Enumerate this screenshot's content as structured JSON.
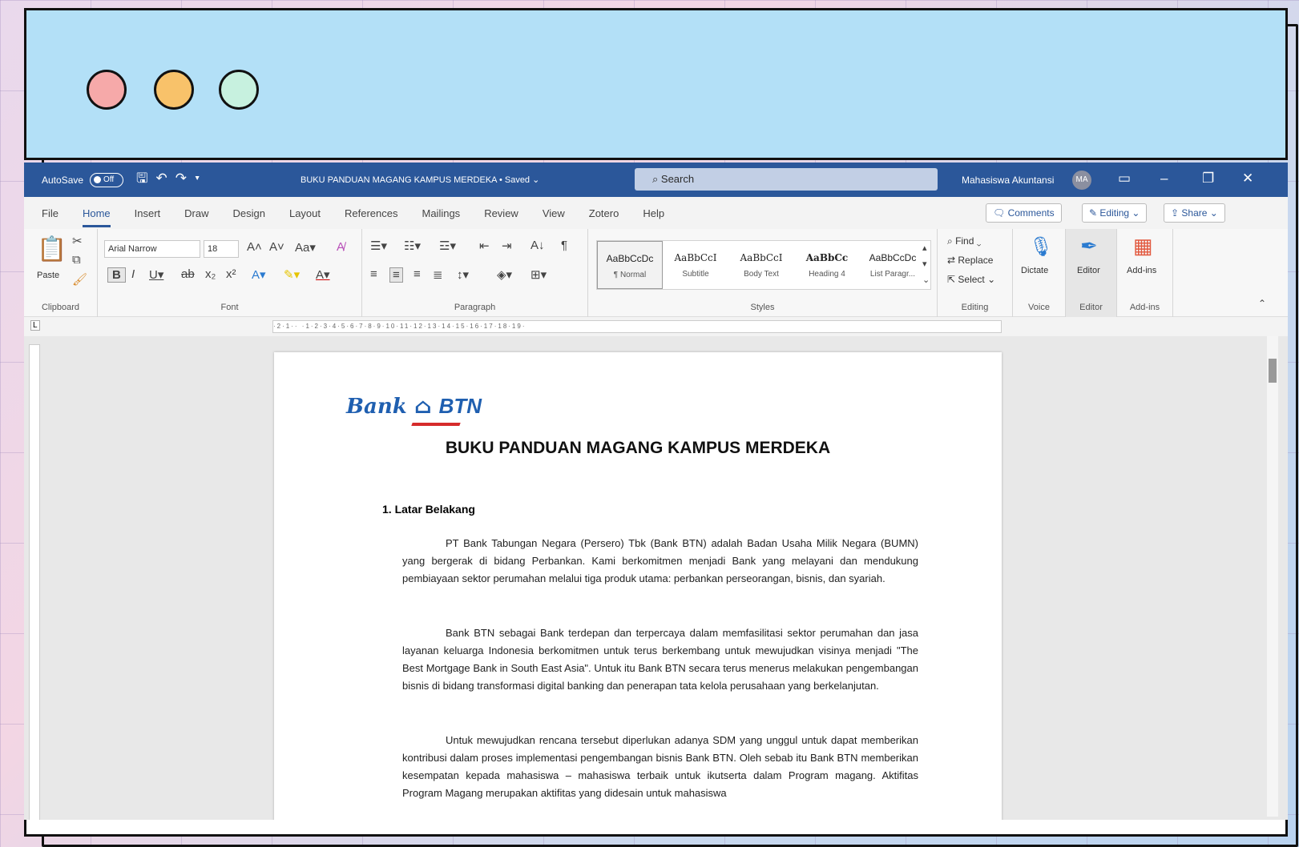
{
  "window_controls": {
    "dots": [
      "close",
      "minimize",
      "maximize"
    ]
  },
  "titlebar": {
    "autosave_label": "AutoSave",
    "autosave_state": "Off",
    "document_title": "BUKU PANDUAN MAGANG KAMPUS MERDEKA • Saved ⌄",
    "search_placeholder": "Search",
    "user_name": "Mahasiswa Akuntansi",
    "user_initials": "MA"
  },
  "tabs": [
    "File",
    "Home",
    "Insert",
    "Draw",
    "Design",
    "Layout",
    "References",
    "Mailings",
    "Review",
    "View",
    "Zotero",
    "Help"
  ],
  "tab_buttons": {
    "comments": "Comments",
    "editing": "Editing ⌄",
    "share": "Share ⌄"
  },
  "ribbon": {
    "clipboard": {
      "paste": "Paste",
      "label": "Clipboard"
    },
    "font": {
      "name": "Arial Narrow",
      "size": "18",
      "label": "Font"
    },
    "paragraph": {
      "label": "Paragraph"
    },
    "styles": {
      "label": "Styles",
      "items": [
        {
          "preview": "AaBbCcDc",
          "name": "¶ Normal"
        },
        {
          "preview": "AaBbCcI",
          "name": "Subtitle"
        },
        {
          "preview": "AaBbCcI",
          "name": "Body Text"
        },
        {
          "preview": "AaBbCc",
          "name": "Heading 4"
        },
        {
          "preview": "AaBbCcDc",
          "name": "List Paragr..."
        }
      ]
    },
    "editing": {
      "find": "Find ⌄",
      "replace": "Replace",
      "select": "Select ⌄",
      "label": "Editing"
    },
    "voice": {
      "dictate": "Dictate",
      "label": "Voice"
    },
    "editor": {
      "button": "Editor",
      "label": "Editor"
    },
    "addins": {
      "button": "Add-ins",
      "label": "Add-ins"
    }
  },
  "document": {
    "logo_bank": "Bank",
    "logo_btn": "BTN",
    "title": "BUKU PANDUAN MAGANG KAMPUS MERDEKA",
    "section_heading": "1.   Latar Belakang",
    "paragraphs": [
      "PT Bank Tabungan Negara (Persero) Tbk (Bank BTN) adalah Badan Usaha Milik Negara (BUMN) yang bergerak di bidang Perbankan. Kami berkomitmen menjadi Bank yang melayani dan mendukung pembiayaan sektor perumahan melalui tiga produk utama: perbankan perseorangan, bisnis, dan syariah.",
      "Bank BTN sebagai Bank terdepan dan terpercaya dalam memfasilitasi sektor perumahan dan jasa layanan keluarga Indonesia berkomitmen untuk terus berkembang untuk mewujudkan visinya menjadi \"The Best Mortgage Bank in South East Asia\". Untuk itu Bank BTN secara terus menerus melakukan pengembangan bisnis di bidang transformasi digital banking dan penerapan tata kelola perusahaan yang berkelanjutan.",
      "Untuk mewujudkan rencana tersebut diperlukan adanya SDM yang unggul untuk dapat memberikan kontribusi dalam proses implementasi pengembangan bisnis Bank BTN. Oleh sebab itu Bank BTN memberikan kesempatan kepada mahasiswa – mahasiswa terbaik untuk ikutserta dalam Program magang. Aktifitas Program Magang merupakan aktifitas yang didesain untuk mahasiswa"
    ]
  },
  "colors": {
    "titlebar": "#2b579a",
    "titlebox": "#b3e0f7",
    "dot_red": "#f6a9a9",
    "dot_yellow": "#f8c26a",
    "dot_green": "#c7f1df"
  }
}
